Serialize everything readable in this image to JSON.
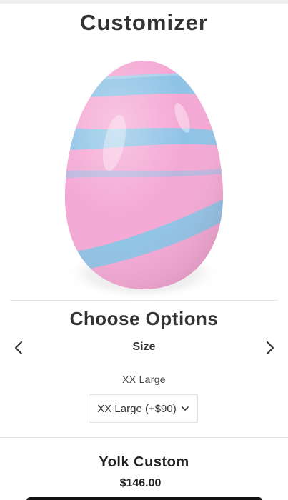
{
  "header": {
    "title": "Customizer"
  },
  "preview": {
    "image_name": "custom-egg-preview",
    "colors": {
      "pink": "#f4a8d4",
      "blue": "#8ec3e6"
    }
  },
  "options": {
    "heading": "Choose Options",
    "current_option": "Size",
    "selected_value_label": "XX Large",
    "select": {
      "selected": "XX Large (+$90)"
    },
    "prev_icon": "chevron-left-icon",
    "next_icon": "chevron-right-icon"
  },
  "product": {
    "name": "Yolk Custom",
    "price": "$146.00"
  }
}
